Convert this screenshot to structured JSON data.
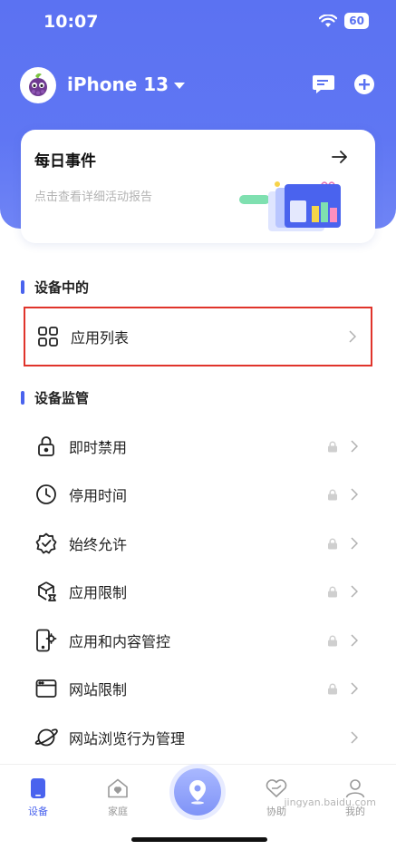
{
  "status_bar": {
    "time": "10:07",
    "battery": "60"
  },
  "header": {
    "device_name": "iPhone 13"
  },
  "daily_card": {
    "title": "每日事件",
    "subtitle": "点击查看详细活动报告"
  },
  "sections": {
    "device": {
      "title": "设备中的",
      "items": [
        {
          "label": "应用列表",
          "icon": "apps-grid-icon"
        }
      ]
    },
    "monitor": {
      "title": "设备监管",
      "items": [
        {
          "label": "即时禁用",
          "icon": "lock-icon"
        },
        {
          "label": "停用时间",
          "icon": "clock-icon"
        },
        {
          "label": "始终允许",
          "icon": "badge-check-icon"
        },
        {
          "label": "应用限制",
          "icon": "app-limit-icon"
        },
        {
          "label": "应用和内容管控",
          "icon": "phone-gear-icon"
        },
        {
          "label": "网站限制",
          "icon": "browser-window-icon"
        },
        {
          "label": "网站浏览行为管理",
          "icon": "planet-icon"
        }
      ]
    }
  },
  "tabbar": {
    "tabs": [
      "设备",
      "家庭",
      "协助",
      "我的"
    ]
  },
  "watermark": "jingyan.baidu.com",
  "colors": {
    "accent": "#4a63ee",
    "header": "#5b72f2",
    "highlight": "#e0342b"
  }
}
